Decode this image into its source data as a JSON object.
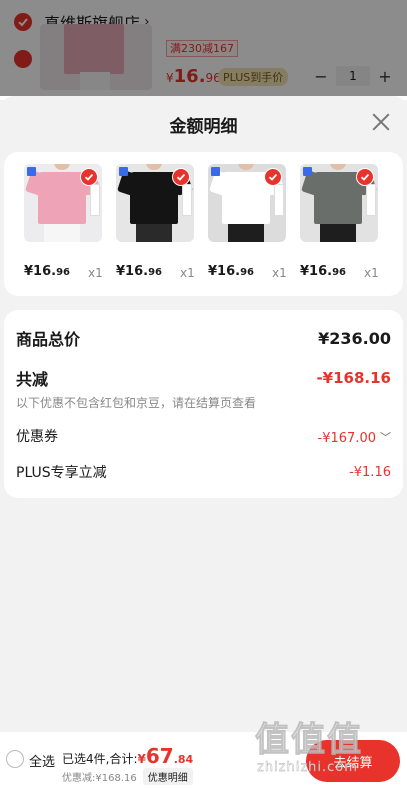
{
  "store": {
    "name": "真维斯旗舰店",
    "arrow": "›"
  },
  "bg_product": {
    "promo": "满230减167",
    "price_yen": "¥",
    "price_int": "16.",
    "price_dec": "96",
    "plus_label": "PLUS到手价",
    "qty": "1",
    "minus": "−",
    "plus": "+"
  },
  "sheet": {
    "title": "金额明细",
    "items": [
      {
        "price_int": "¥16.",
        "price_dec": "96",
        "qty": "x1",
        "shirt_color": "#efa3b6",
        "bg_color": "#ecebee",
        "pants_color": "#f6f6f6"
      },
      {
        "price_int": "¥16.",
        "price_dec": "96",
        "qty": "x1",
        "shirt_color": "#141414",
        "bg_color": "#e6e6e6",
        "pants_color": "#2a2a2a"
      },
      {
        "price_int": "¥16.",
        "price_dec": "96",
        "qty": "x1",
        "shirt_color": "#ffffff",
        "bg_color": "#dcdcdc",
        "pants_color": "#1e1e1e"
      },
      {
        "price_int": "¥16.",
        "price_dec": "96",
        "qty": "x1",
        "shirt_color": "#6a6e6a",
        "bg_color": "#e2e2e2",
        "pants_color": "#1e1e1e"
      }
    ],
    "summary": {
      "total_label": "商品总价",
      "total_value": "¥236.00",
      "reduce_label": "共减",
      "reduce_value": "-¥168.16",
      "hint": "以下优惠不包含红包和京豆，请在结算页查看",
      "coupon_label": "优惠券",
      "coupon_value": "-¥167.00",
      "plus_label": "PLUS专享立减",
      "plus_value": "-¥1.16"
    }
  },
  "bottom": {
    "select_all": "全选",
    "selected_text": "已选4件,合计:",
    "total_yen": "¥",
    "total_int": "67",
    "total_dec": ".84",
    "discount_text": "优惠减:¥168.16",
    "detail_chip": "优惠明细",
    "checkout": "去结算"
  },
  "watermark": {
    "glyphs": "值值值",
    "url": "zhizhizhi.com"
  },
  "colors": {
    "accent": "#e8332c",
    "plus_gold": "#f3e3b4"
  }
}
